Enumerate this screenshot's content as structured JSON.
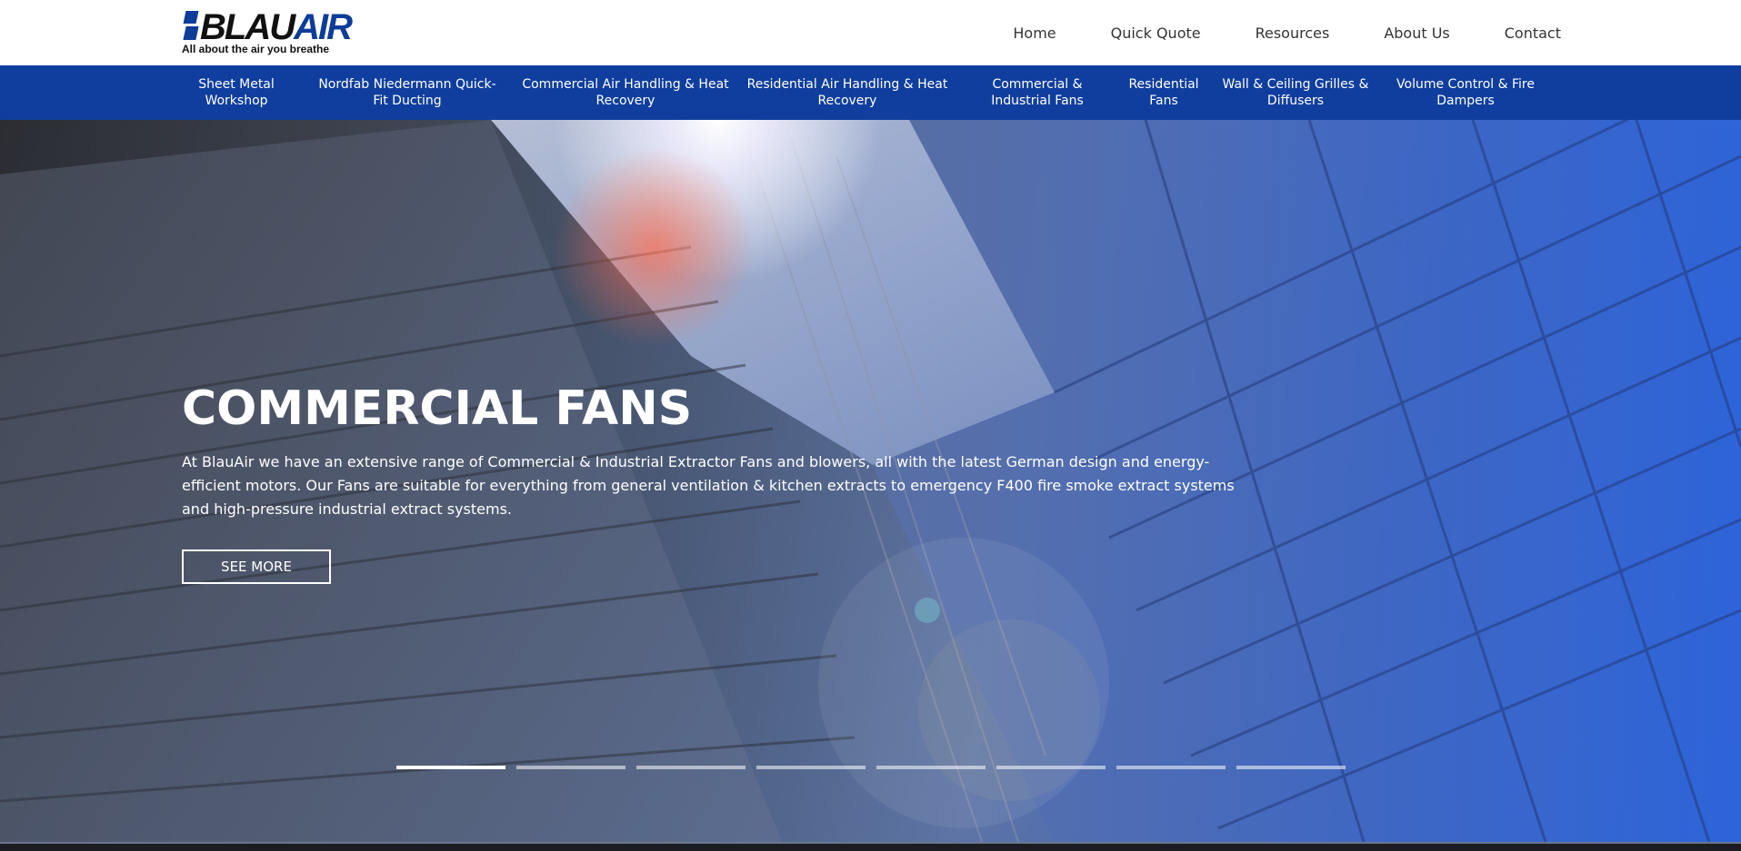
{
  "brand": {
    "logo_blau": "BLAU",
    "logo_air": "AIR",
    "tagline": "All about the air you breathe",
    "color_primary": "#0f3e9e"
  },
  "main_nav": [
    {
      "label": "Home"
    },
    {
      "label": "Quick Quote"
    },
    {
      "label": "Resources"
    },
    {
      "label": "About Us"
    },
    {
      "label": "Contact"
    }
  ],
  "categories": [
    {
      "label": "Sheet Metal Workshop"
    },
    {
      "label": "Nordfab Niedermann Quick-Fit Ducting"
    },
    {
      "label": "Commercial Air Handling & Heat Recovery"
    },
    {
      "label": "Residential Air Handling & Heat Recovery"
    },
    {
      "label": "Commercial & Industrial Fans"
    },
    {
      "label": "Residential Fans"
    },
    {
      "label": "Wall & Ceiling Grilles & Diffusers"
    },
    {
      "label": "Volume Control & Fire Dampers"
    }
  ],
  "hero": {
    "title": "COMMERCIAL FANS",
    "description": "At BlauAir we have an extensive range of Commercial & Industrial Extractor Fans and blowers, all with the latest German design and energy-efficient motors. Our Fans are suitable for everything from general ventilation & kitchen extracts to emergency F400 fire smoke extract systems and high-pressure industrial extract systems.",
    "button_label": "SEE MORE",
    "slide_count": 8,
    "active_slide": 1
  }
}
